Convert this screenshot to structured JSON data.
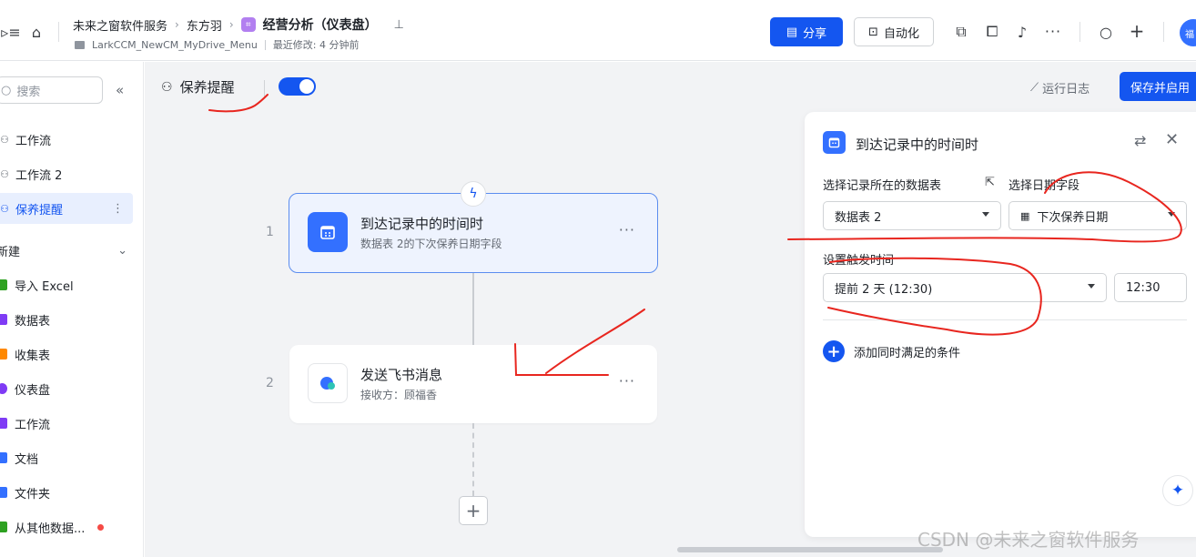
{
  "topbar": {
    "breadcrumb": [
      "未来之窗软件服务",
      "东方羽"
    ],
    "title": "经营分析（仪表盘）",
    "drive_path": "LarkCCM_NewCM_MyDrive_Menu",
    "last_modified": "最近修改: 4 分钟前",
    "share_label": "分享",
    "automation_label": "自动化",
    "avatar_text": "福"
  },
  "sidebar": {
    "search_placeholder": "搜索",
    "items": [
      {
        "label": "工作流"
      },
      {
        "label": "工作流 2"
      },
      {
        "label": "保养提醒",
        "active": true
      }
    ],
    "new_group_label": "新建",
    "new_items": [
      {
        "label": "导入 Excel",
        "color": "#2ea121"
      },
      {
        "label": "数据表",
        "color": "#7f3bf5"
      },
      {
        "label": "收集表",
        "color": "#ff8800"
      },
      {
        "label": "仪表盘",
        "color": "#7f3bf5"
      },
      {
        "label": "工作流",
        "color": "#7f3bf5"
      },
      {
        "label": "文档",
        "color": "#3370ff"
      },
      {
        "label": "文件夹",
        "color": "#3370ff"
      },
      {
        "label": "从其他数据...",
        "color": "#2ea121"
      }
    ]
  },
  "workflow": {
    "name": "保养提醒",
    "enabled": true,
    "run_log_label": "运行日志",
    "save_label": "保存并启用",
    "steps": [
      {
        "number": "1",
        "title": "到达记录中的时间时",
        "subtitle": "数据表 2的下次保养日期字段"
      },
      {
        "number": "2",
        "title": "发送飞书消息",
        "subtitle": "接收方：顾福香"
      }
    ]
  },
  "panel": {
    "title": "到达记录中的时间时",
    "table_label": "选择记录所在的数据表",
    "table_value": "数据表 2",
    "date_field_label": "选择日期字段",
    "date_field_value": "下次保养日期",
    "trigger_time_label": "设置触发时间",
    "trigger_time_value": "提前 2 天 (12:30)",
    "time_value": "12:30",
    "add_condition_label": "添加同时满足的条件"
  },
  "watermark": "CSDN @未来之窗软件服务",
  "colors": {
    "accent": "#1456f0",
    "annotation": "#e8261f"
  }
}
